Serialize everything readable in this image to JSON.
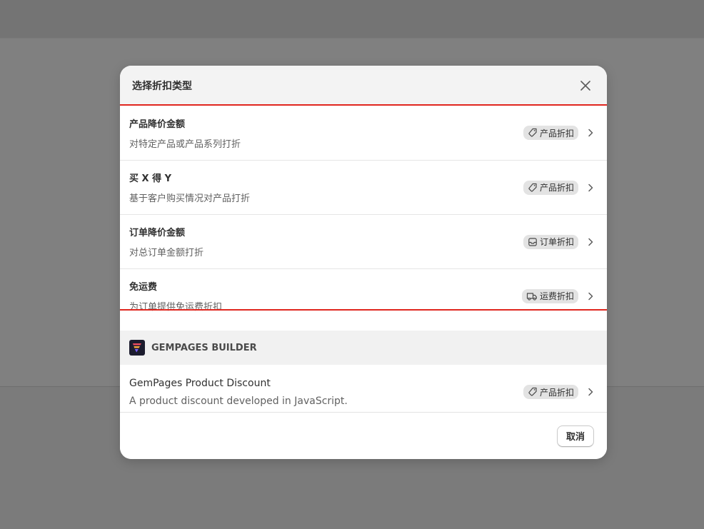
{
  "dialog": {
    "title": "选择折扣类型",
    "close_icon": "close-icon"
  },
  "options": [
    {
      "title": "产品降价金额",
      "description": "对特定产品或产品系列打折",
      "badge_label": "产品折扣",
      "badge_icon": "tag-icon"
    },
    {
      "title": "买 X 得 Y",
      "description": "基于客户购买情况对产品打折",
      "badge_label": "产品折扣",
      "badge_icon": "tag-icon"
    },
    {
      "title": "订单降价金额",
      "description": "对总订单金额打折",
      "badge_label": "订单折扣",
      "badge_icon": "receipt-icon"
    },
    {
      "title": "免运费",
      "description": "为订单提供免运费折扣",
      "badge_label": "运费折扣",
      "badge_icon": "truck-icon"
    }
  ],
  "app_section": {
    "name": "GEMPAGES BUILDER",
    "logo_icon": "gempages-logo-icon",
    "options": [
      {
        "title": "GemPages Product Discount",
        "description": "A product discount developed in JavaScript.",
        "badge_label": "产品折扣",
        "badge_icon": "tag-icon"
      }
    ]
  },
  "footer": {
    "cancel_label": "取消"
  },
  "colors": {
    "highlight": "#e0261e",
    "badge_bg": "#e3e3e3",
    "header_bg": "#f3f3f3",
    "overlay": "#7b7b7b"
  }
}
